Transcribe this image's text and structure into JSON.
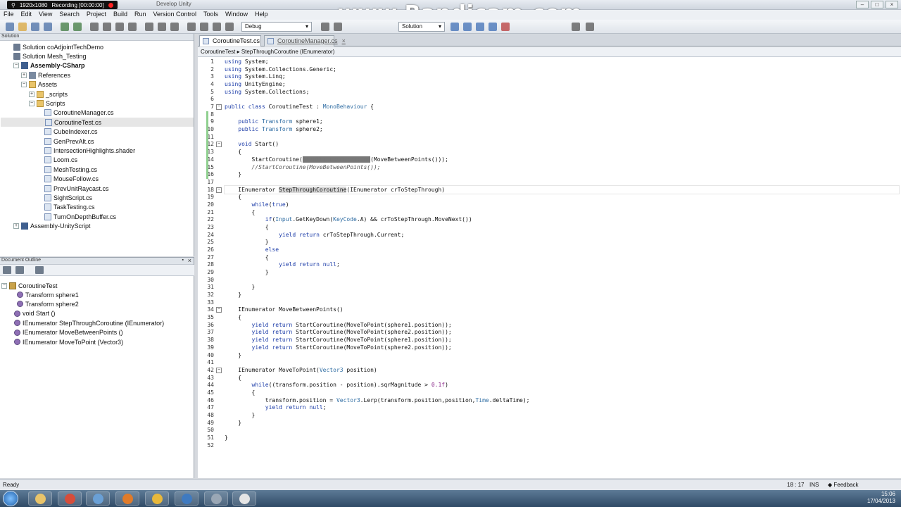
{
  "recorder": {
    "resolution": "1920x1080",
    "status": "Recording [00:00:00]"
  },
  "window_title": "Develop Unity",
  "watermark": "www.Bandicam.com",
  "menu": [
    "File",
    "Edit",
    "View",
    "Search",
    "Project",
    "Build",
    "Run",
    "Version Control",
    "Tools",
    "Window",
    "Help"
  ],
  "toolbar": {
    "config": "Debug",
    "platform": "Solution"
  },
  "solution_pad": {
    "title": "Solution",
    "items": [
      {
        "label": "Solution coAdjointTechDemo",
        "level": 0,
        "icon": "sol",
        "exp": "",
        "selected": false
      },
      {
        "label": "Solution Mesh_Testing",
        "level": 0,
        "icon": "sol",
        "exp": "",
        "selected": false
      },
      {
        "label": "Assembly-CSharp",
        "level": 1,
        "icon": "asm",
        "exp": "−",
        "selected": false,
        "bold": true
      },
      {
        "label": "References",
        "level": 2,
        "icon": "ref",
        "exp": "+",
        "selected": false
      },
      {
        "label": "Assets",
        "level": 2,
        "icon": "folder",
        "exp": "−",
        "selected": false
      },
      {
        "label": "_scripts",
        "level": 3,
        "icon": "folder",
        "exp": "+",
        "selected": false
      },
      {
        "label": "Scripts",
        "level": 3,
        "icon": "folder",
        "exp": "−",
        "selected": false
      },
      {
        "label": "CoroutineManager.cs",
        "level": 4,
        "icon": "cs",
        "exp": "",
        "selected": false
      },
      {
        "label": "CoroutineTest.cs",
        "level": 4,
        "icon": "cs",
        "exp": "",
        "selected": true
      },
      {
        "label": "CubeIndexer.cs",
        "level": 4,
        "icon": "cs",
        "exp": "",
        "selected": false
      },
      {
        "label": "GenPrevAlt.cs",
        "level": 4,
        "icon": "cs",
        "exp": "",
        "selected": false
      },
      {
        "label": "IntersectionHighlights.shader",
        "level": 4,
        "icon": "cs",
        "exp": "",
        "selected": false
      },
      {
        "label": "Loom.cs",
        "level": 4,
        "icon": "cs",
        "exp": "",
        "selected": false
      },
      {
        "label": "MeshTesting.cs",
        "level": 4,
        "icon": "cs",
        "exp": "",
        "selected": false
      },
      {
        "label": "MouseFollow.cs",
        "level": 4,
        "icon": "cs",
        "exp": "",
        "selected": false
      },
      {
        "label": "PrevUnitRaycast.cs",
        "level": 4,
        "icon": "cs",
        "exp": "",
        "selected": false
      },
      {
        "label": "SightScript.cs",
        "level": 4,
        "icon": "cs",
        "exp": "",
        "selected": false
      },
      {
        "label": "TaskTesting.cs",
        "level": 4,
        "icon": "cs",
        "exp": "",
        "selected": false
      },
      {
        "label": "TurnOnDepthBuffer.cs",
        "level": 4,
        "icon": "cs",
        "exp": "",
        "selected": false
      },
      {
        "label": "Assembly-UnityScript",
        "level": 1,
        "icon": "asm",
        "exp": "+",
        "selected": false
      }
    ]
  },
  "outline_pad": {
    "title": "Document Outline",
    "class_name": "CoroutineTest",
    "members": [
      "Transform sphere1",
      "Transform sphere2",
      "void Start ()",
      "IEnumerator StepThroughCoroutine (IEnumerator)",
      "IEnumerator MoveBetweenPoints ()",
      "IEnumerator MoveToPoint (Vector3)"
    ]
  },
  "tabs": [
    {
      "label": "CoroutineTest.cs",
      "active": true
    },
    {
      "label": "CoroutineManager.cs",
      "active": false
    }
  ],
  "breadcrumb": {
    "class": "CoroutineTest",
    "member": "StepThroughCoroutine (IEnumerator)"
  },
  "code_lines": [
    "using System;",
    "using System.Collections.Generic;",
    "using System.Linq;",
    "using UnityEngine;",
    "using System.Collections;",
    "",
    "public class CoroutineTest : MonoBehaviour {",
    "",
    "    public Transform sphere1;",
    "    public Transform sphere2;",
    "",
    "    void Start()",
    "    {",
    "        StartCoroutine(StepThroughCoroutine(MoveBetweenPoints()));",
    "        //StartCoroutine(MoveBetweenPoints());",
    "    }",
    "",
    "    IEnumerator StepThroughCoroutine(IEnumerator crToStepThrough)",
    "    {",
    "        while(true)",
    "        {",
    "            if(Input.GetKeyDown(KeyCode.A) && crToStepThrough.MoveNext())",
    "            {",
    "                yield return crToStepThrough.Current;",
    "            }",
    "            else",
    "            {",
    "                yield return null;",
    "            }",
    "",
    "        }",
    "    }",
    "",
    "    IEnumerator MoveBetweenPoints()",
    "    {",
    "        yield return StartCoroutine(MoveToPoint(sphere1.position));",
    "        yield return StartCoroutine(MoveToPoint(sphere2.position));",
    "        yield return StartCoroutine(MoveToPoint(sphere1.position));",
    "        yield return StartCoroutine(MoveToPoint(sphere2.position));",
    "    }",
    "",
    "    IEnumerator MoveToPoint(Vector3 position)",
    "    {",
    "        while((transform.position - position).sqrMagnitude > 0.1f)",
    "        {",
    "            transform.position = Vector3.Lerp(transform.position,position,Time.deltaTime);",
    "            yield return null;",
    "        }",
    "    }",
    "",
    "}",
    ""
  ],
  "fold_lines": [
    7,
    12,
    18,
    34,
    42
  ],
  "current_line": 18,
  "status": {
    "left": "Ready",
    "position": "18 : 17",
    "mode": "INS",
    "feedback": "Feedback"
  },
  "clock": {
    "time": "15:06",
    "date": "17/04/2013"
  }
}
